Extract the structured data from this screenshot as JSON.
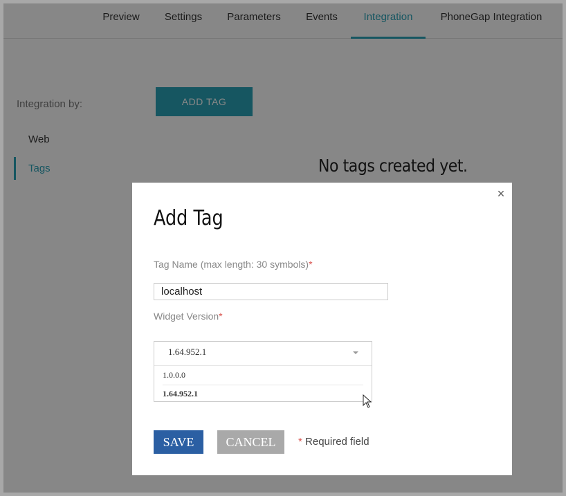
{
  "nav": {
    "tabs": [
      {
        "label": "Preview"
      },
      {
        "label": "Settings"
      },
      {
        "label": "Parameters"
      },
      {
        "label": "Events"
      },
      {
        "label": "Integration"
      },
      {
        "label": "PhoneGap Integration"
      }
    ],
    "active_tab": "Integration"
  },
  "sidebar": {
    "heading": "Integration by:",
    "items": [
      {
        "label": "Web"
      },
      {
        "label": "Tags"
      }
    ],
    "active_item": "Tags"
  },
  "main": {
    "add_tag_label": "ADD TAG",
    "empty_message": "No tags created yet."
  },
  "modal": {
    "title": "Add Tag",
    "close_icon": "close-icon",
    "tag_name_label": "Tag Name (max length: 30 symbols)",
    "required_star": "*",
    "tag_name_value": "localhost",
    "widget_version_label": "Widget Version",
    "widget_version_selected": "1.64.952.1",
    "widget_version_options": [
      "1.0.0.0",
      "1.64.952.1"
    ],
    "save_label": "SAVE",
    "cancel_label": "CANCEL",
    "required_note": "Required field"
  },
  "colors": {
    "accent": "#2aa3b8",
    "save_button": "#2b5fa3",
    "cancel_button": "#a9a9a9",
    "required": "#d9534f"
  }
}
